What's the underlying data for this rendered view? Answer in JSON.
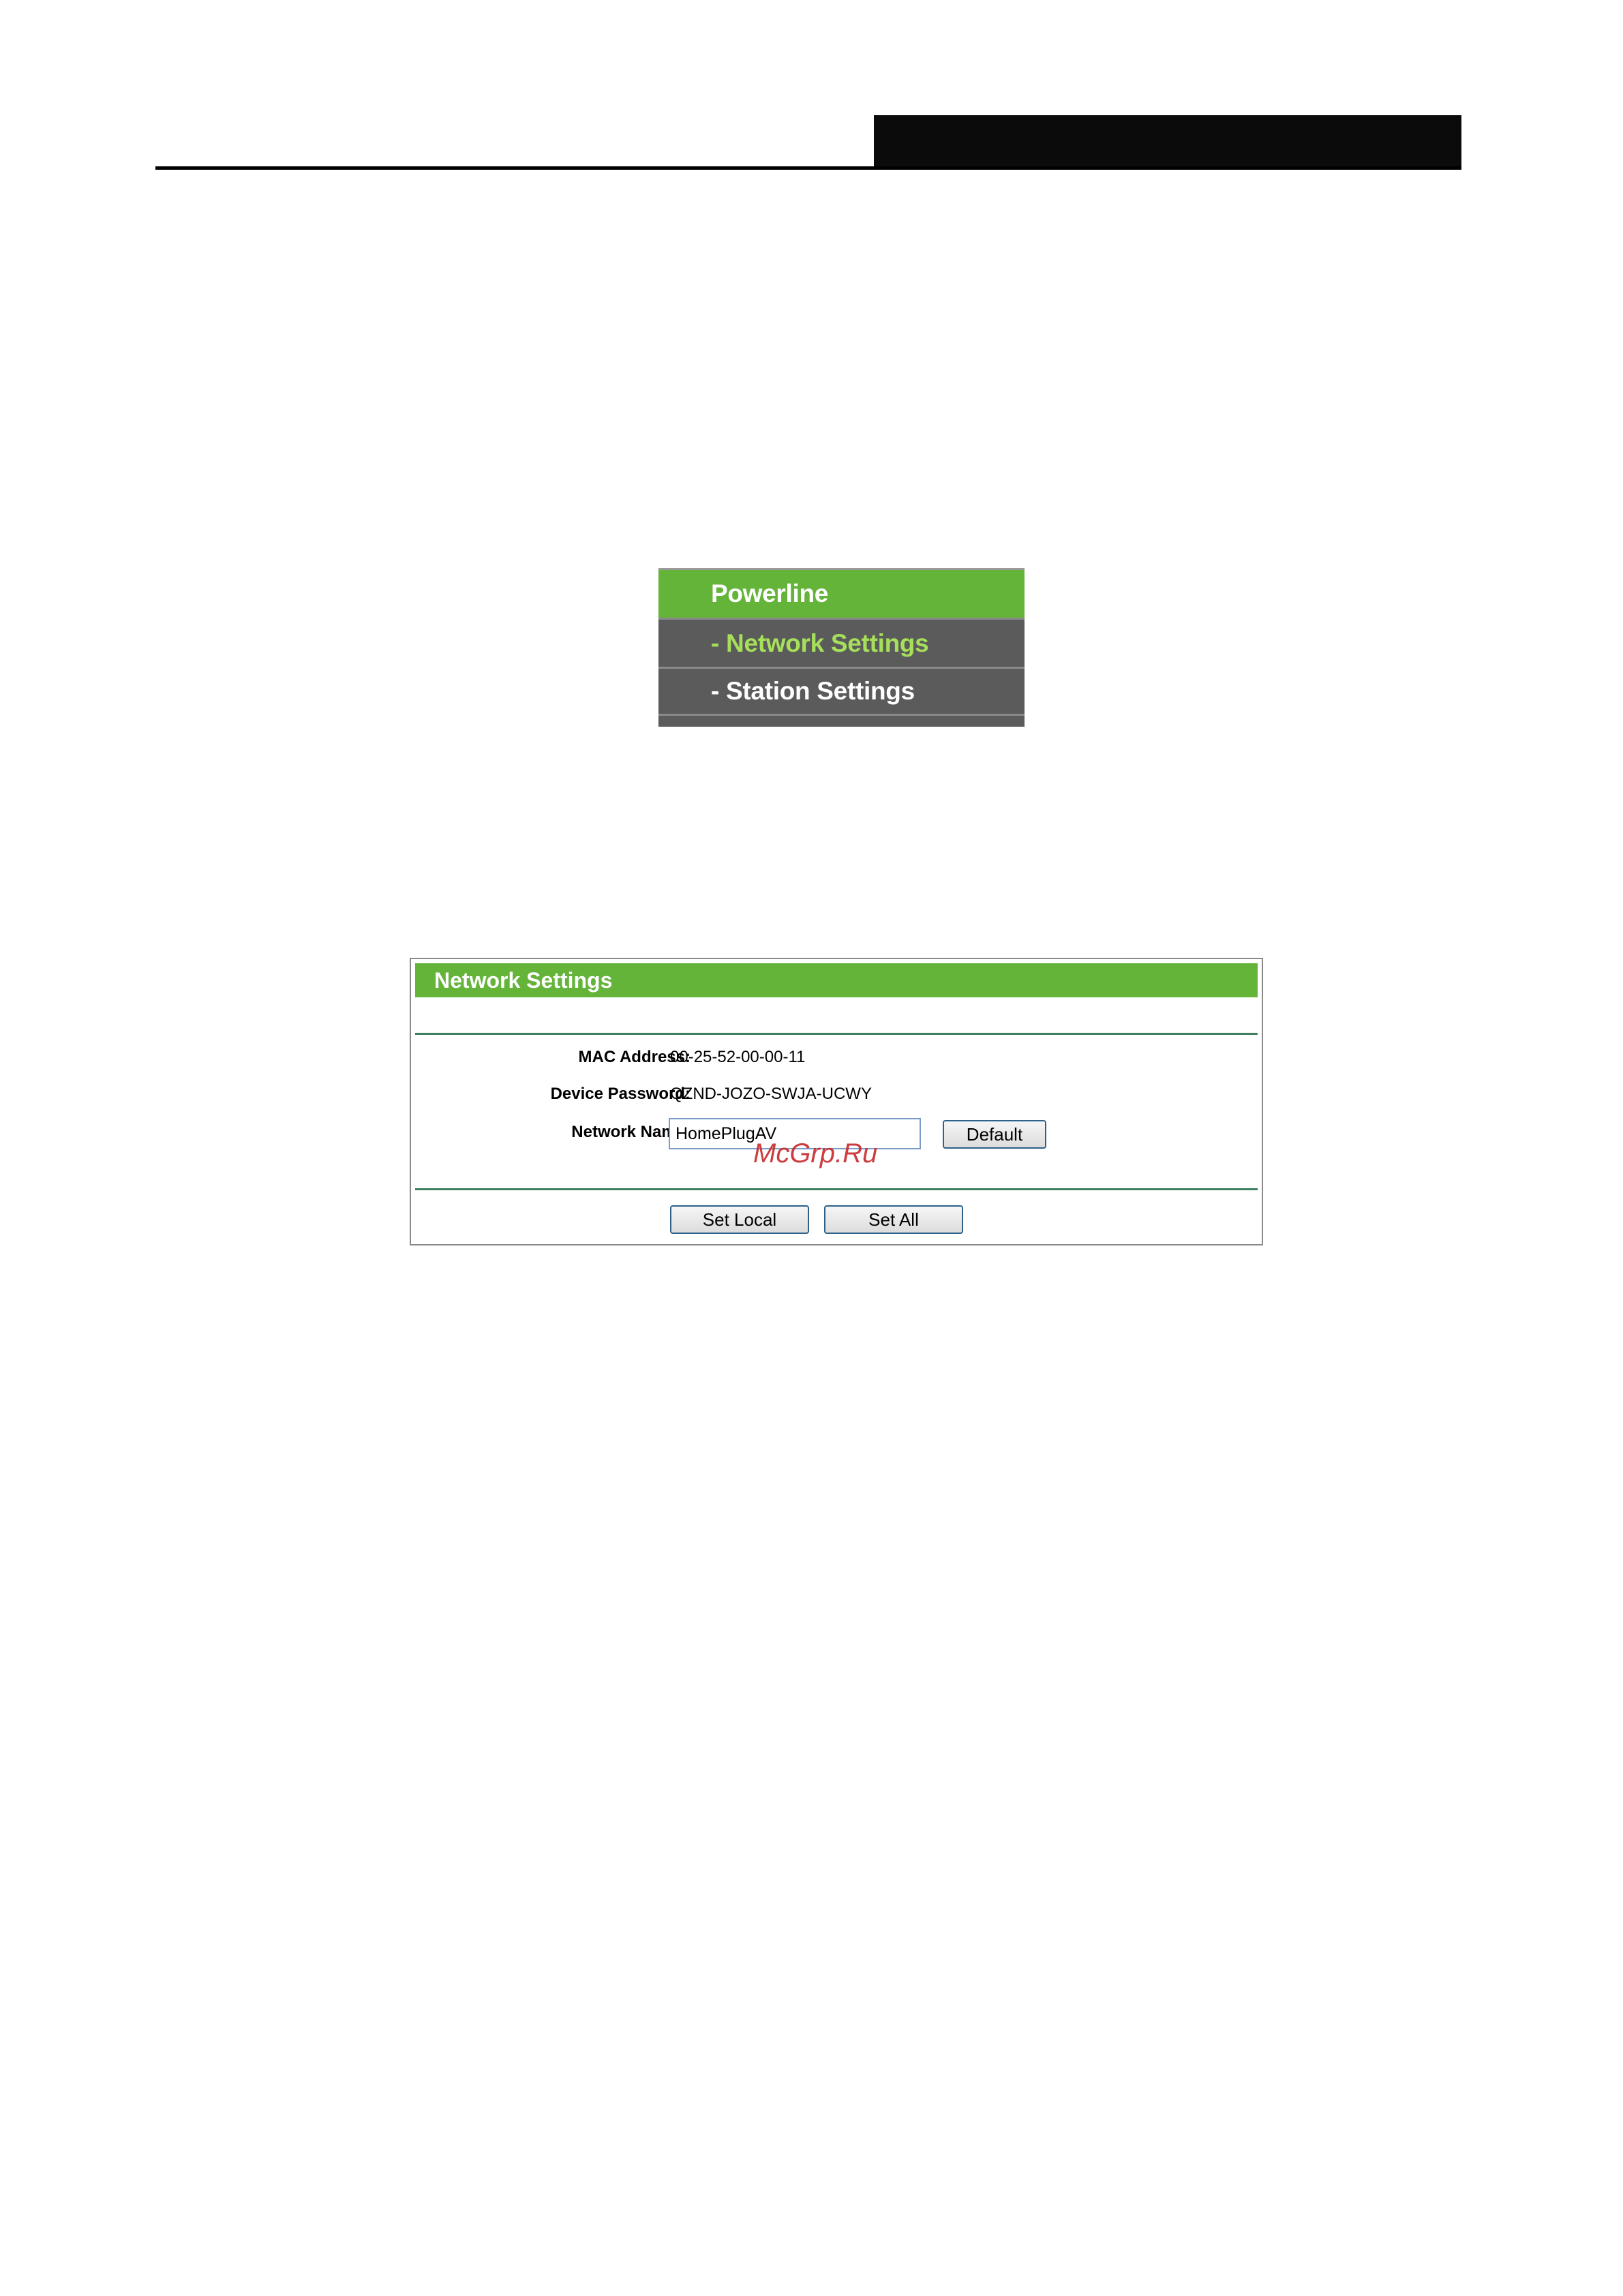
{
  "menu": {
    "title": "Powerline",
    "items": [
      {
        "prefix": "-",
        "label": "Network Settings"
      },
      {
        "prefix": "-",
        "label": "Station Settings"
      }
    ]
  },
  "panel": {
    "title": "Network Settings",
    "mac_label": "MAC Address:",
    "mac_value": "00-25-52-00-00-11",
    "password_label": "Device Password:",
    "password_value": "QZND-JOZO-SWJA-UCWY",
    "network_name_label": "Network Name:",
    "network_name_value": "HomePlugAV",
    "default_label": "Default",
    "set_local_label": "Set Local",
    "set_all_label": "Set All"
  },
  "watermark": "McGrp.Ru",
  "colors": {
    "accent_green": "#64b43a",
    "menu_bg": "#5b5b5b",
    "active_item_text": "#a6e05a"
  }
}
